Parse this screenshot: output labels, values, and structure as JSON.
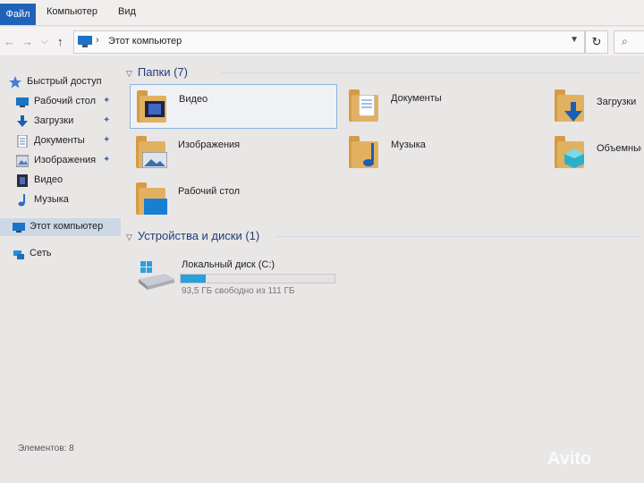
{
  "ribbon": {
    "file": "Файл",
    "computer": "Компьютер",
    "view": "Вид"
  },
  "nav": {
    "back": "←",
    "forward": "→",
    "dropdown": "⌵",
    "up": "↑"
  },
  "address": {
    "separator": "›",
    "path": "Этот компьютер",
    "refresh": "↻",
    "search_icon": "⌕"
  },
  "sidebar": {
    "items": [
      {
        "label": "Быстрый доступ",
        "icon": "star-icon"
      },
      {
        "label": "Рабочий стол",
        "icon": "desktop-icon",
        "pinned": true
      },
      {
        "label": "Загрузки",
        "icon": "download-icon",
        "pinned": true
      },
      {
        "label": "Документы",
        "icon": "document-icon",
        "pinned": true
      },
      {
        "label": "Изображения",
        "icon": "image-icon",
        "pinned": true
      },
      {
        "label": "Видео",
        "icon": "video-icon"
      },
      {
        "label": "Музыка",
        "icon": "music-icon"
      },
      {
        "label": "Этот компьютер",
        "icon": "computer-icon",
        "selected": true
      },
      {
        "label": "Сеть",
        "icon": "network-icon"
      }
    ],
    "pin_glyph": "📌"
  },
  "folders": {
    "header": "Папки (7)",
    "items": [
      {
        "name": "Видео",
        "icon": "video-folder-icon",
        "selected": true
      },
      {
        "name": "Документы",
        "icon": "documents-folder-icon"
      },
      {
        "name": "Загрузки",
        "icon": "downloads-folder-icon"
      },
      {
        "name": "Изображения",
        "icon": "pictures-folder-icon"
      },
      {
        "name": "Музыка",
        "icon": "music-folder-icon"
      },
      {
        "name": "Объемные о",
        "icon": "3d-objects-folder-icon"
      },
      {
        "name": "Рабочий стол",
        "icon": "desktop-folder-icon"
      }
    ]
  },
  "devices": {
    "header": "Устройства и диски (1)",
    "drive": {
      "name": "Локальный диск (C:)",
      "free_text": "93,5 ГБ свободно из 111 ГБ",
      "used_fraction": 0.16
    }
  },
  "status": {
    "text": "Элементов: 8"
  },
  "watermark": "Avito",
  "colors": {
    "accent": "#1f63b8",
    "header_text": "#1f3e7a",
    "drive_bar": "#27a0dc",
    "folder": "#e2b160"
  }
}
